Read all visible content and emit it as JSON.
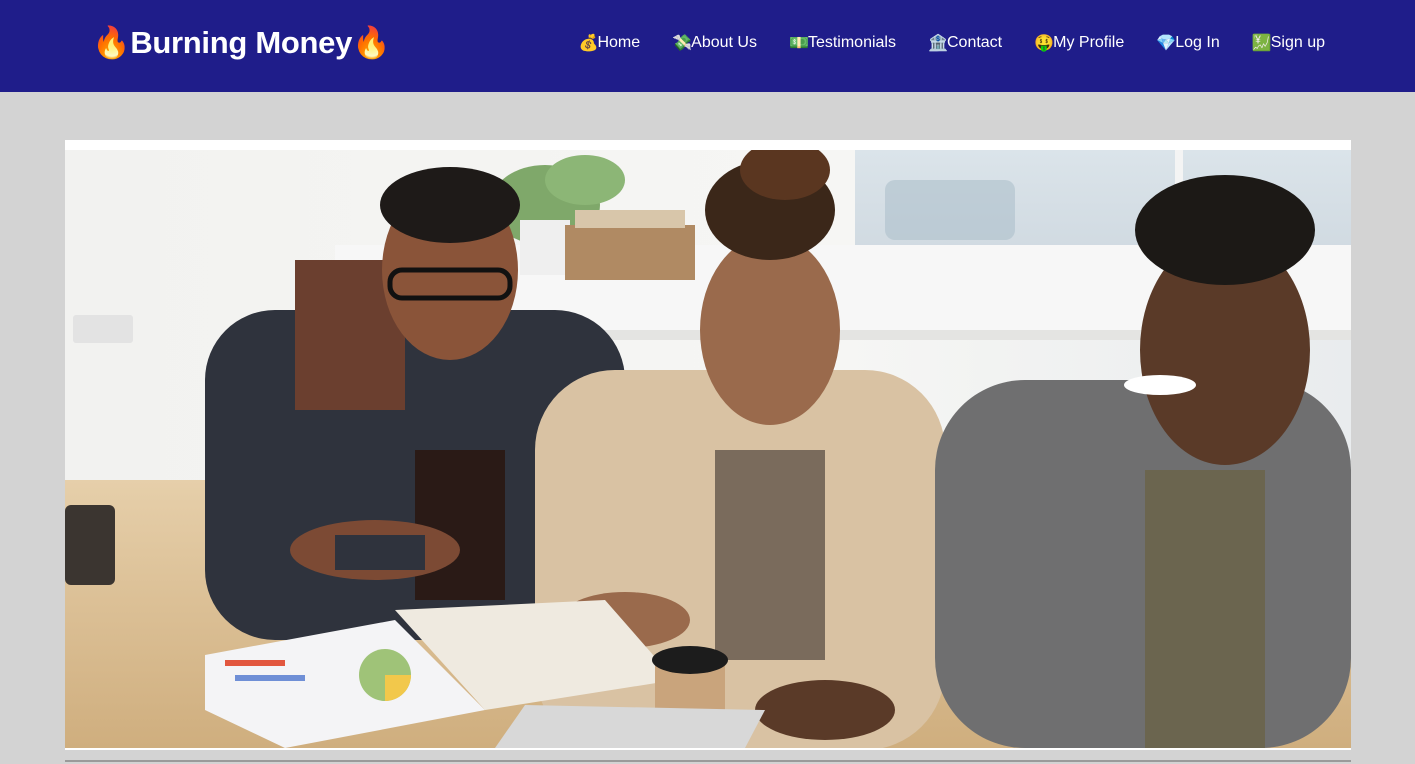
{
  "navbar": {
    "brand": {
      "icon_left": "🔥",
      "text": "Burning Money",
      "icon_right": "🔥"
    },
    "links": [
      {
        "icon": "💰",
        "icon_name": "money-bag-icon",
        "label": "Home"
      },
      {
        "icon": "💸",
        "icon_name": "money-wings-icon",
        "label": "About Us"
      },
      {
        "icon": "💵",
        "icon_name": "banknote-icon",
        "label": "Testimonials"
      },
      {
        "icon": "🏦",
        "icon_name": "bank-icon",
        "label": "Contact"
      },
      {
        "icon": "🤑",
        "icon_name": "money-face-icon",
        "label": "My Profile"
      },
      {
        "icon": "💎",
        "icon_name": "gem-icon",
        "label": "Log In"
      },
      {
        "icon": "💹",
        "icon_name": "chart-yen-icon",
        "label": "Sign up"
      }
    ],
    "colors": {
      "background": "#1f1d8a",
      "text": "#ffffff"
    }
  },
  "hero": {
    "image_subject": "three smiling colleagues at an office table with charts, notebooks and a coffee cup"
  },
  "page": {
    "background": "#d3d3d3"
  }
}
